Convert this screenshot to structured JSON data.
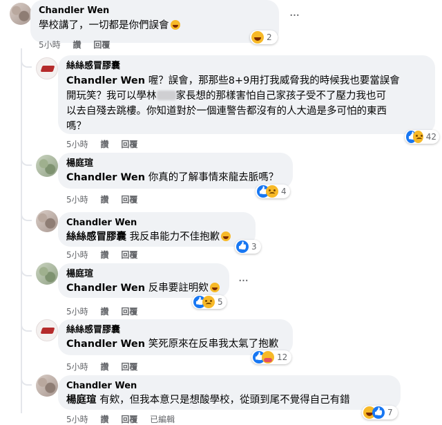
{
  "actions": {
    "like": "讚",
    "reply": "回覆",
    "edited": "已編輯"
  },
  "comments": [
    {
      "author": "Chandler Wen",
      "text": "學校講了，一切都是你們誤會",
      "time": "5小時",
      "reaction_icons": [
        "haha-icon"
      ],
      "reaction_count": "2"
    },
    {
      "author": "絲絲感冒膠囊",
      "tag": "Chandler Wen",
      "text_lines": [
        "喔？誤會，那那些8+9用打我威脅我的時候我也要當誤會",
        "開玩笑？我可以學林",
        "家長想的那樣害怕自己家孩子受不了壓力我也可",
        "以去自殘去跳樓。你知道對於一個連警告都沒有的人大過是多可怕的東西",
        "嗎？"
      ],
      "time": "5小時",
      "reaction_icons": [
        "like-icon",
        "sad-icon"
      ],
      "reaction_count": "42"
    },
    {
      "author": "楊庭瑄",
      "tag": "Chandler Wen",
      "text": "你真的了解事情來龍去脈嗎？",
      "time": "5小時",
      "reaction_icons": [
        "like-icon",
        "sad-icon"
      ],
      "reaction_count": "4"
    },
    {
      "author": "Chandler Wen",
      "tag": "絲絲感冒膠囊",
      "text": "我反串能力不佳抱歉",
      "time": "5小時",
      "reaction_icons": [
        "like-icon"
      ],
      "reaction_count": "3"
    },
    {
      "author": "楊庭瑄",
      "tag": "Chandler Wen",
      "text": "反串要註明欸",
      "time": "5小時",
      "reaction_icons": [
        "like-icon",
        "sad-icon"
      ],
      "reaction_count": "5"
    },
    {
      "author": "絲絲感冒膠囊",
      "tag": "Chandler Wen",
      "text": "笑死原來在反串我太氣了抱歉",
      "time": "5小時",
      "reaction_icons": [
        "like-icon",
        "care-icon"
      ],
      "reaction_count": "12"
    },
    {
      "author": "Chandler Wen",
      "tag": "楊庭瑄",
      "text": "有欸，但我本意只是想酸學校，從頭到尾不覺得自己有錯",
      "time": "5小時",
      "reaction_icons": [
        "haha-icon",
        "like-icon"
      ],
      "reaction_count": "7"
    }
  ]
}
